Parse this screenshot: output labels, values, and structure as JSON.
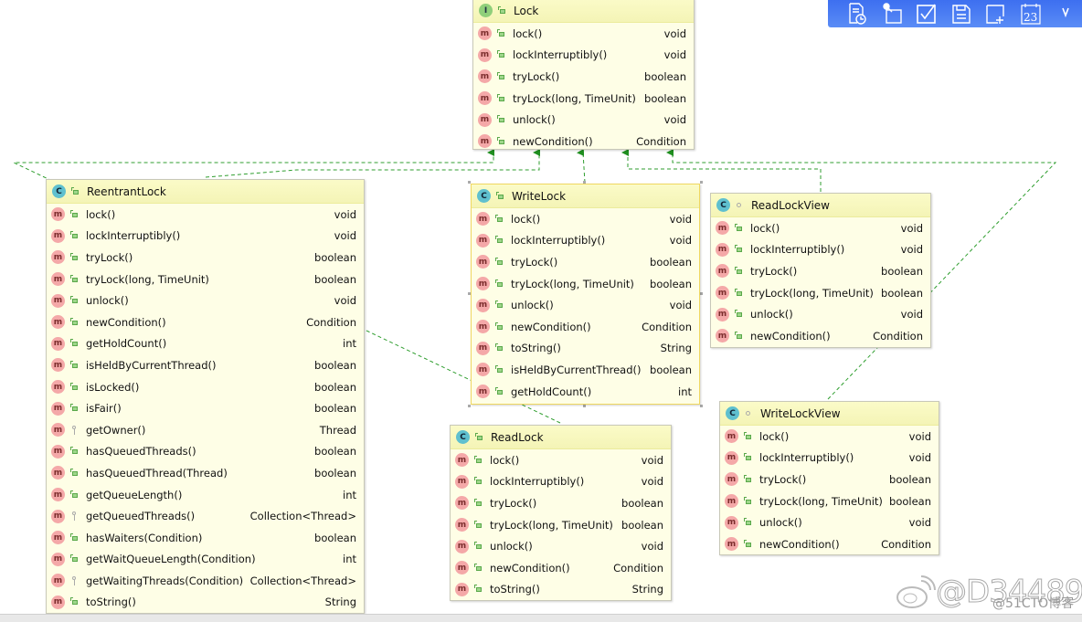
{
  "colors": {
    "edge": "#2f9e2f",
    "toolbar": "#4a7ff3",
    "box_fill": "#fefee6",
    "header_fill": "#f6f6bc",
    "method_icon": "#f4a8a8"
  },
  "toolbar": {
    "icons": [
      "report-clock-icon",
      "key-folder-icon",
      "checkbox-icon",
      "document-icon",
      "add-window-icon",
      "calendar-icon",
      "more-icon"
    ],
    "calendar_text": "23"
  },
  "classes": {
    "lock": {
      "name": "Lock",
      "kind": "interface",
      "kind_letter": "I",
      "visibility": "public",
      "selected": false,
      "members": [
        {
          "name": "lock()",
          "type": "void",
          "vis": "public"
        },
        {
          "name": "lockInterruptibly()",
          "type": "void",
          "vis": "public"
        },
        {
          "name": "tryLock()",
          "type": "boolean",
          "vis": "public"
        },
        {
          "name": "tryLock(long, TimeUnit)",
          "type": "boolean",
          "vis": "public"
        },
        {
          "name": "unlock()",
          "type": "void",
          "vis": "public"
        },
        {
          "name": "newCondition()",
          "type": "Condition",
          "vis": "public"
        }
      ]
    },
    "reentrantLock": {
      "name": "ReentrantLock",
      "kind": "class",
      "kind_letter": "C",
      "visibility": "public",
      "selected": false,
      "members": [
        {
          "name": "lock()",
          "type": "void",
          "vis": "public"
        },
        {
          "name": "lockInterruptibly()",
          "type": "void",
          "vis": "public"
        },
        {
          "name": "tryLock()",
          "type": "boolean",
          "vis": "public"
        },
        {
          "name": "tryLock(long, TimeUnit)",
          "type": "boolean",
          "vis": "public"
        },
        {
          "name": "unlock()",
          "type": "void",
          "vis": "public"
        },
        {
          "name": "newCondition()",
          "type": "Condition",
          "vis": "public"
        },
        {
          "name": "getHoldCount()",
          "type": "int",
          "vis": "public"
        },
        {
          "name": "isHeldByCurrentThread()",
          "type": "boolean",
          "vis": "public"
        },
        {
          "name": "isLocked()",
          "type": "boolean",
          "vis": "public"
        },
        {
          "name": "isFair()",
          "type": "boolean",
          "vis": "public"
        },
        {
          "name": "getOwner()",
          "type": "Thread",
          "vis": "protected"
        },
        {
          "name": "hasQueuedThreads()",
          "type": "boolean",
          "vis": "public"
        },
        {
          "name": "hasQueuedThread(Thread)",
          "type": "boolean",
          "vis": "public"
        },
        {
          "name": "getQueueLength()",
          "type": "int",
          "vis": "public"
        },
        {
          "name": "getQueuedThreads()",
          "type": "Collection<Thread>",
          "vis": "protected"
        },
        {
          "name": "hasWaiters(Condition)",
          "type": "boolean",
          "vis": "public"
        },
        {
          "name": "getWaitQueueLength(Condition)",
          "type": "int",
          "vis": "public"
        },
        {
          "name": "getWaitingThreads(Condition)",
          "type": "Collection<Thread>",
          "vis": "protected"
        },
        {
          "name": "toString()",
          "type": "String",
          "vis": "public"
        }
      ]
    },
    "writeLock": {
      "name": "WriteLock",
      "kind": "class",
      "kind_letter": "C",
      "visibility": "public",
      "selected": true,
      "members": [
        {
          "name": "lock()",
          "type": "void",
          "vis": "public"
        },
        {
          "name": "lockInterruptibly()",
          "type": "void",
          "vis": "public"
        },
        {
          "name": "tryLock()",
          "type": "boolean",
          "vis": "public"
        },
        {
          "name": "tryLock(long, TimeUnit)",
          "type": "boolean",
          "vis": "public"
        },
        {
          "name": "unlock()",
          "type": "void",
          "vis": "public"
        },
        {
          "name": "newCondition()",
          "type": "Condition",
          "vis": "public"
        },
        {
          "name": "toString()",
          "type": "String",
          "vis": "public"
        },
        {
          "name": "isHeldByCurrentThread()",
          "type": "boolean",
          "vis": "public"
        },
        {
          "name": "getHoldCount()",
          "type": "int",
          "vis": "public"
        }
      ]
    },
    "readLockView": {
      "name": "ReadLockView",
      "kind": "class",
      "kind_letter": "C",
      "visibility": "package",
      "selected": false,
      "members": [
        {
          "name": "lock()",
          "type": "void",
          "vis": "public"
        },
        {
          "name": "lockInterruptibly()",
          "type": "void",
          "vis": "public"
        },
        {
          "name": "tryLock()",
          "type": "boolean",
          "vis": "public"
        },
        {
          "name": "tryLock(long, TimeUnit)",
          "type": "boolean",
          "vis": "public"
        },
        {
          "name": "unlock()",
          "type": "void",
          "vis": "public"
        },
        {
          "name": "newCondition()",
          "type": "Condition",
          "vis": "public"
        }
      ]
    },
    "readLock": {
      "name": "ReadLock",
      "kind": "class",
      "kind_letter": "C",
      "visibility": "public",
      "selected": false,
      "members": [
        {
          "name": "lock()",
          "type": "void",
          "vis": "public"
        },
        {
          "name": "lockInterruptibly()",
          "type": "void",
          "vis": "public"
        },
        {
          "name": "tryLock()",
          "type": "boolean",
          "vis": "public"
        },
        {
          "name": "tryLock(long, TimeUnit)",
          "type": "boolean",
          "vis": "public"
        },
        {
          "name": "unlock()",
          "type": "void",
          "vis": "public"
        },
        {
          "name": "newCondition()",
          "type": "Condition",
          "vis": "public"
        },
        {
          "name": "toString()",
          "type": "String",
          "vis": "public"
        }
      ]
    },
    "writeLockView": {
      "name": "WriteLockView",
      "kind": "class",
      "kind_letter": "C",
      "visibility": "package",
      "selected": false,
      "members": [
        {
          "name": "lock()",
          "type": "void",
          "vis": "public"
        },
        {
          "name": "lockInterruptibly()",
          "type": "void",
          "vis": "public"
        },
        {
          "name": "tryLock()",
          "type": "boolean",
          "vis": "public"
        },
        {
          "name": "tryLock(long, TimeUnit)",
          "type": "boolean",
          "vis": "public"
        },
        {
          "name": "unlock()",
          "type": "void",
          "vis": "public"
        },
        {
          "name": "newCondition()",
          "type": "Condition",
          "vis": "public"
        }
      ]
    }
  },
  "method_letter": "m",
  "relations": [
    {
      "from": "ReentrantLock",
      "to": "Lock",
      "type": "implements"
    },
    {
      "from": "WriteLock",
      "to": "Lock",
      "type": "implements"
    },
    {
      "from": "ReadLock",
      "to": "Lock",
      "type": "implements"
    },
    {
      "from": "ReadLockView",
      "to": "Lock",
      "type": "implements"
    },
    {
      "from": "WriteLockView",
      "to": "Lock",
      "type": "implements"
    }
  ],
  "watermark": {
    "main": "@D34489",
    "sub": "@51CTO博客"
  }
}
